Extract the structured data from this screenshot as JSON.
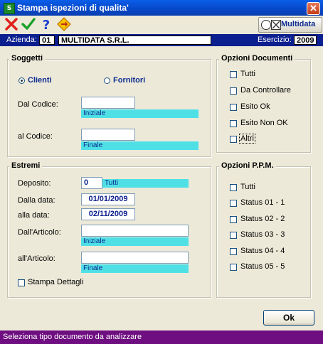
{
  "window": {
    "title": "Stampa ispezioni di qualita'",
    "icon_letter": "S"
  },
  "toolbar": {
    "brand": "Multidata"
  },
  "info": {
    "azienda_label": "Azienda:",
    "azienda_code": "01",
    "azienda_name": "MULTIDATA S.R.L.",
    "esercizio_label": "Esercizio:",
    "esercizio_value": "2009"
  },
  "soggetti": {
    "title": "Soggetti",
    "radio_clienti": "Clienti",
    "radio_fornitori": "Fornitori",
    "dal_codice_label": "Dal Codice:",
    "dal_codice_value": "",
    "dal_codice_hint": "Iniziale",
    "al_codice_label": "al Codice:",
    "al_codice_value": "",
    "al_codice_hint": "Finale"
  },
  "estremi": {
    "title": "Estremi",
    "deposito_label": "Deposito:",
    "deposito_value": "0",
    "deposito_hint": "Tutti",
    "dalla_data_label": "Dalla data:",
    "dalla_data_value": "01/01/2009",
    "alla_data_label": "alla data:",
    "alla_data_value": "02/11/2009",
    "dall_articolo_label": "Dall'Articolo:",
    "dall_articolo_value": "",
    "dall_articolo_hint": "Iniziale",
    "all_articolo_label": "all'Articolo:",
    "all_articolo_value": "",
    "all_articolo_hint": "Finale",
    "stampa_dettagli": "Stampa Dettagli"
  },
  "opzioni_documenti": {
    "title": "Opzioni Documenti",
    "items": [
      "Tutti",
      "Da Controllare",
      "Esito Ok",
      "Esito Non OK",
      "Altri"
    ]
  },
  "opzioni_ppm": {
    "title": "Opzioni P.P.M.",
    "items": [
      "Tutti",
      "Status 01 - 1",
      "Status 02 - 2",
      "Status 03 - 3",
      "Status 04 - 4",
      "Status 05 - 5"
    ]
  },
  "buttons": {
    "ok": "Ok"
  },
  "status": {
    "text": "Seleziona tipo documento da analizzare"
  }
}
